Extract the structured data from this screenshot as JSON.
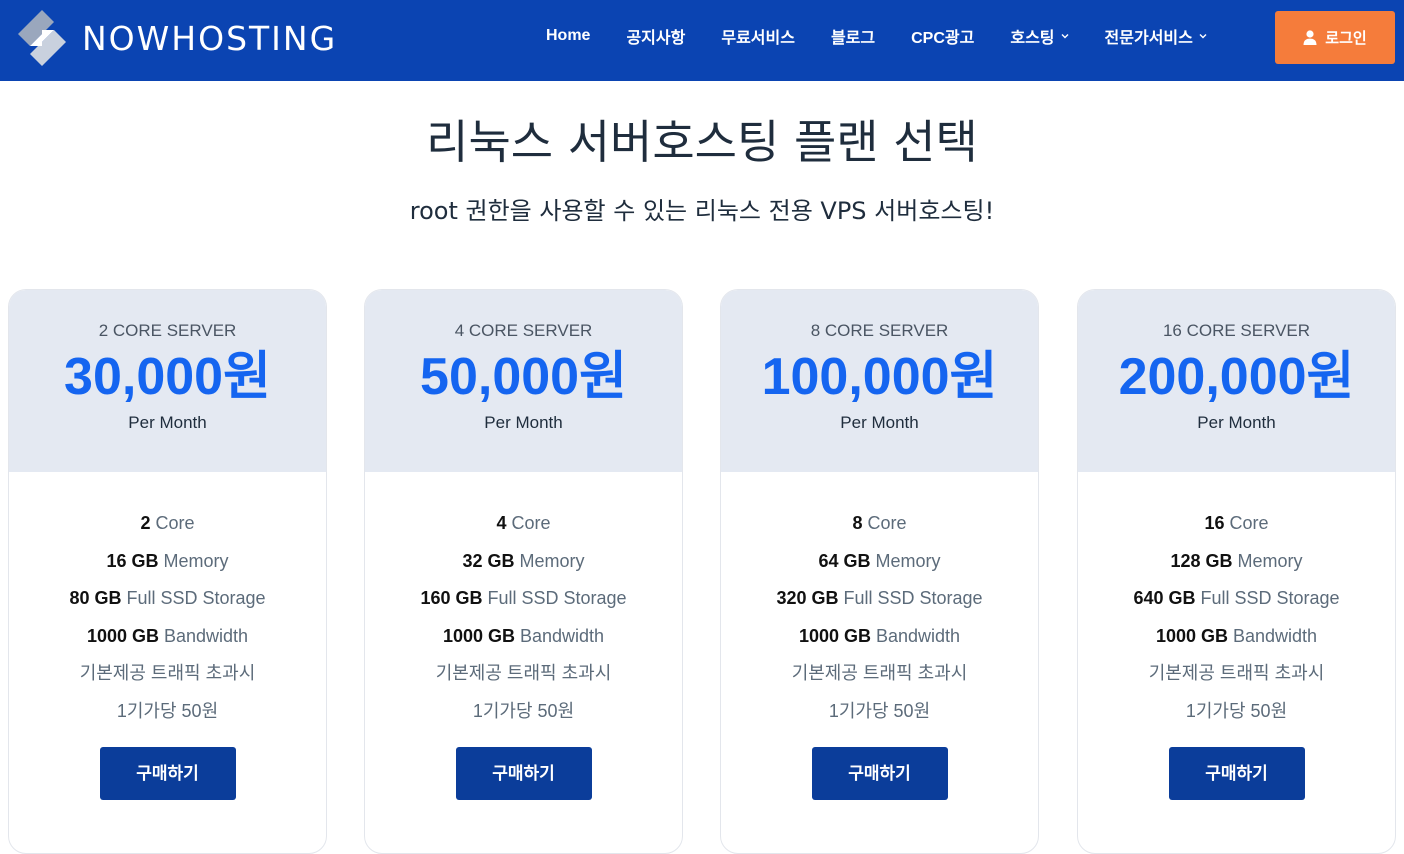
{
  "brand": {
    "name": "NOWHOSTING",
    "logo_icon": "nowhosting-logo-icon"
  },
  "nav": {
    "items": [
      {
        "label": "Home",
        "dropdown": false
      },
      {
        "label": "공지사항",
        "dropdown": false
      },
      {
        "label": "무료서비스",
        "dropdown": false
      },
      {
        "label": "블로그",
        "dropdown": false
      },
      {
        "label": "CPC광고",
        "dropdown": false
      },
      {
        "label": "호스팅",
        "dropdown": true
      },
      {
        "label": "전문가서비스",
        "dropdown": true
      }
    ],
    "login_label": "로그인",
    "login_icon": "user-icon"
  },
  "page": {
    "title": "리눅스 서버호스팅 플랜 선택",
    "subtitle": "root 권한을 사용할 수 있는 리눅스 전용 VPS 서버호스팅!"
  },
  "colors": {
    "header_bg": "#0b44b2",
    "login_bg": "#f57c3b",
    "price": "#1565f0",
    "buy_bg": "#0b3d9a",
    "card_head_bg": "#e4e9f2"
  },
  "plans": [
    {
      "tier": "2 CORE SERVER",
      "price": "30,000원",
      "period": "Per Month",
      "core_value": "2",
      "core_label": "Core",
      "memory_value": "16 GB",
      "memory_label": "Memory",
      "storage_value": "80 GB",
      "storage_label": "Full SSD Storage",
      "bandwidth_value": "1000 GB",
      "bandwidth_label": "Bandwidth",
      "note1": "기본제공 트래픽 초과시",
      "note2": "1기가당 50원",
      "buy_label": "구매하기"
    },
    {
      "tier": "4 CORE SERVER",
      "price": "50,000원",
      "period": "Per Month",
      "core_value": "4",
      "core_label": "Core",
      "memory_value": "32 GB",
      "memory_label": "Memory",
      "storage_value": "160 GB",
      "storage_label": "Full SSD Storage",
      "bandwidth_value": "1000 GB",
      "bandwidth_label": "Bandwidth",
      "note1": "기본제공 트래픽 초과시",
      "note2": "1기가당 50원",
      "buy_label": "구매하기"
    },
    {
      "tier": "8 CORE SERVER",
      "price": "100,000원",
      "period": "Per Month",
      "core_value": "8",
      "core_label": "Core",
      "memory_value": "64 GB",
      "memory_label": "Memory",
      "storage_value": "320 GB",
      "storage_label": "Full SSD Storage",
      "bandwidth_value": "1000 GB",
      "bandwidth_label": "Bandwidth",
      "note1": "기본제공 트래픽 초과시",
      "note2": "1기가당 50원",
      "buy_label": "구매하기"
    },
    {
      "tier": "16 CORE SERVER",
      "price": "200,000원",
      "period": "Per Month",
      "core_value": "16",
      "core_label": "Core",
      "memory_value": "128 GB",
      "memory_label": "Memory",
      "storage_value": "640 GB",
      "storage_label": "Full SSD Storage",
      "bandwidth_value": "1000 GB",
      "bandwidth_label": "Bandwidth",
      "note1": "기본제공 트래픽 초과시",
      "note2": "1기가당 50원",
      "buy_label": "구매하기"
    }
  ]
}
